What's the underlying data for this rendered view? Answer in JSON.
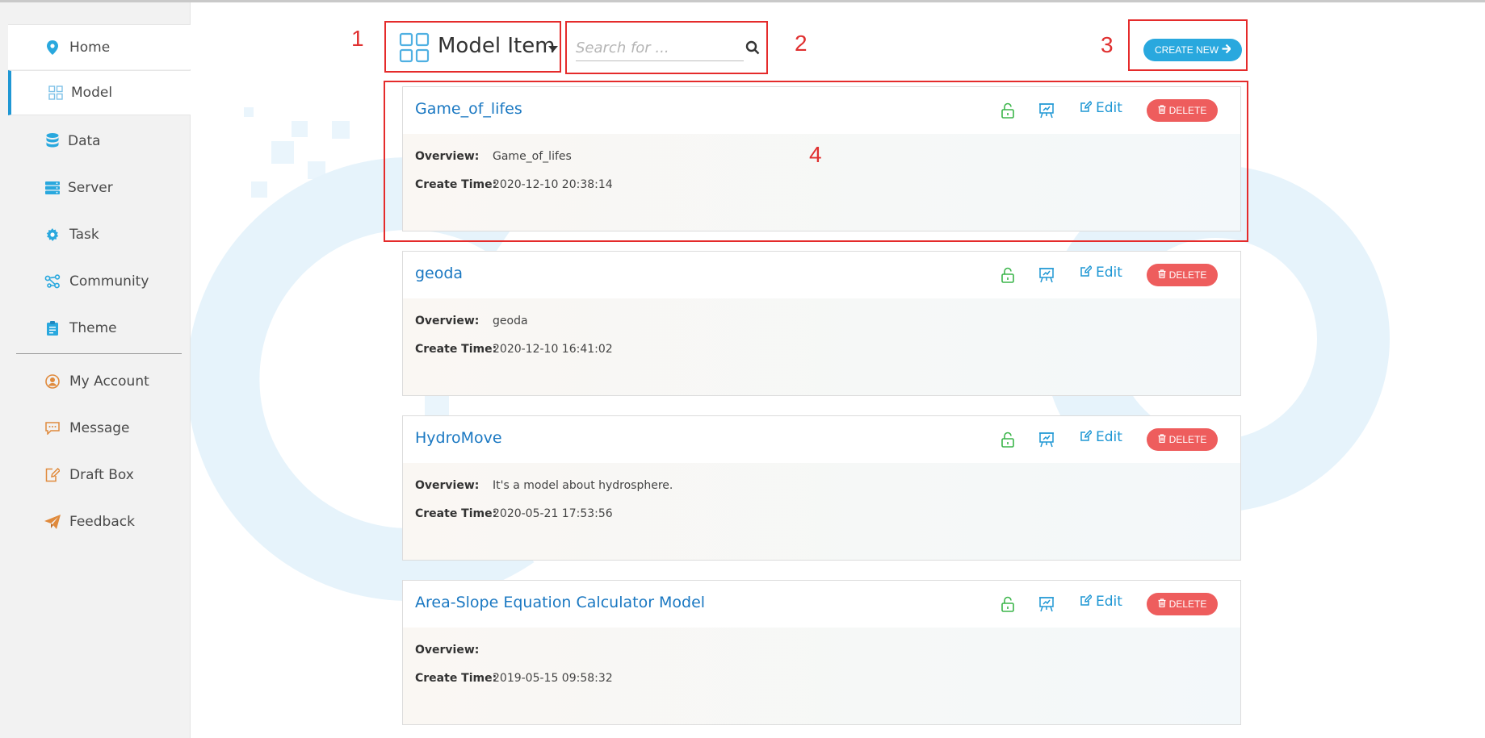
{
  "sidebar": {
    "items": [
      {
        "label": "Home",
        "icon": "map-pin-icon"
      },
      {
        "label": "Model",
        "icon": "grid-icon",
        "active": true
      },
      {
        "label": "Data",
        "icon": "database-icon"
      },
      {
        "label": "Server",
        "icon": "server-icon"
      },
      {
        "label": "Task",
        "icon": "gear-icon"
      },
      {
        "label": "Community",
        "icon": "share-nodes-icon"
      },
      {
        "label": "Theme",
        "icon": "clipboard-icon"
      }
    ],
    "account_items": [
      {
        "label": "My Account",
        "icon": "user-circle-icon"
      },
      {
        "label": "Message",
        "icon": "message-icon"
      },
      {
        "label": "Draft Box",
        "icon": "edit-file-icon"
      },
      {
        "label": "Feedback",
        "icon": "paper-plane-icon"
      }
    ]
  },
  "header": {
    "title": "Model Item",
    "search_placeholder": "Search for ...",
    "create_label": "CREATE NEW"
  },
  "annotations": [
    "1",
    "2",
    "3",
    "4"
  ],
  "card_labels": {
    "overview": "Overview:",
    "create_time": "Create Time:",
    "edit": "Edit",
    "delete": "DELETE"
  },
  "items": [
    {
      "title": "Game_of_lifes",
      "overview": "Game_of_lifes",
      "create_time": "2020-12-10 20:38:14"
    },
    {
      "title": "geoda",
      "overview": "geoda",
      "create_time": "2020-12-10 16:41:02"
    },
    {
      "title": "HydroMove",
      "overview": "It's a model about hydrosphere.",
      "create_time": "2020-05-21 17:53:56"
    },
    {
      "title": "Area-Slope Equation Calculator Model",
      "overview": "",
      "create_time": "2019-05-15 09:58:32"
    }
  ],
  "colors": {
    "accent": "#1f97d4",
    "title_blue": "#1a78c2",
    "delete_red": "#ee5d5d",
    "unlock_green": "#3bb54a",
    "annotation_red": "#e52b2b"
  }
}
